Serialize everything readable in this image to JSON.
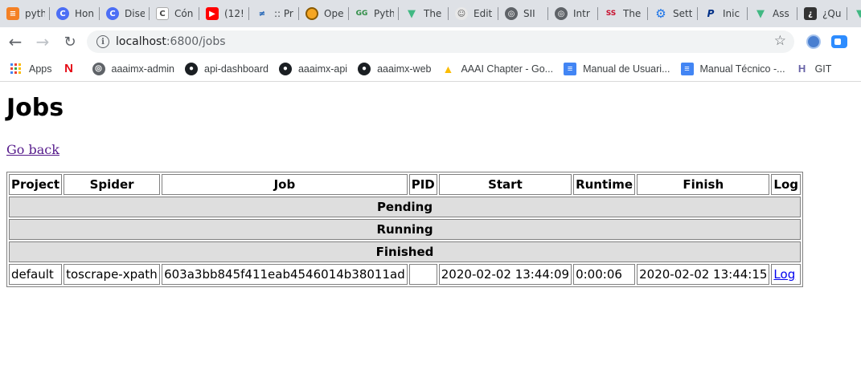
{
  "browser": {
    "tabs": [
      {
        "label": "pyth",
        "icon": "stackoverflow-icon"
      },
      {
        "label": "Hon",
        "icon": "c-circle-icon"
      },
      {
        "label": "Dise",
        "icon": "c-circle-icon"
      },
      {
        "label": "Cón",
        "icon": "chrome-store-icon"
      },
      {
        "label": "(12!",
        "icon": "youtube-icon"
      },
      {
        "label": ":: Pr",
        "icon": "tec-logo-icon"
      },
      {
        "label": "Ope",
        "icon": "orange-circle-icon"
      },
      {
        "label": "Pyth",
        "icon": "geeksforgeeks-icon"
      },
      {
        "label": "The",
        "icon": "vue-icon"
      },
      {
        "label": "Edit",
        "icon": "alien-icon"
      },
      {
        "label": "SII",
        "icon": "globe-icon"
      },
      {
        "label": "Intr",
        "icon": "globe-icon"
      },
      {
        "label": "The",
        "icon": "red-logo-icon"
      },
      {
        "label": "Sett",
        "icon": "gear-icon"
      },
      {
        "label": "Inic",
        "icon": "paypal-icon"
      },
      {
        "label": "Ass",
        "icon": "vue-icon"
      },
      {
        "label": "¿Qu",
        "icon": "dark-square-icon"
      },
      {
        "label": "",
        "icon": "vue-icon"
      }
    ],
    "url_host": "localhost",
    "url_path": ":6800/jobs",
    "bookmarks": [
      {
        "label": "Apps",
        "icon": "apps-grid-icon"
      },
      {
        "label": "",
        "icon": "netflix-icon"
      },
      {
        "label": "aaaimx-admin",
        "icon": "globe-icon"
      },
      {
        "label": "api-dashboard",
        "icon": "github-icon"
      },
      {
        "label": "aaaimx-api",
        "icon": "github-icon"
      },
      {
        "label": "aaaimx-web",
        "icon": "github-icon"
      },
      {
        "label": "AAAI Chapter - Go...",
        "icon": "google-drive-icon"
      },
      {
        "label": "Manual de Usuari...",
        "icon": "google-docs-icon"
      },
      {
        "label": "Manual Técnico -...",
        "icon": "google-docs-icon"
      },
      {
        "label": "GIT",
        "icon": "heroku-icon"
      }
    ]
  },
  "page": {
    "title": "Jobs",
    "back_link": "Go back",
    "table": {
      "headers": [
        "Project",
        "Spider",
        "Job",
        "PID",
        "Start",
        "Runtime",
        "Finish",
        "Log"
      ],
      "sections": [
        "Pending",
        "Running",
        "Finished"
      ],
      "finished_rows": [
        {
          "project": "default",
          "spider": "toscrape-xpath",
          "job": "603a3bb845f411eab4546014b38011ad",
          "pid": "",
          "start": "2020-02-02 13:44:09",
          "runtime": "0:00:06",
          "finish": "2020-02-02 13:44:15",
          "log": "Log"
        }
      ]
    }
  }
}
